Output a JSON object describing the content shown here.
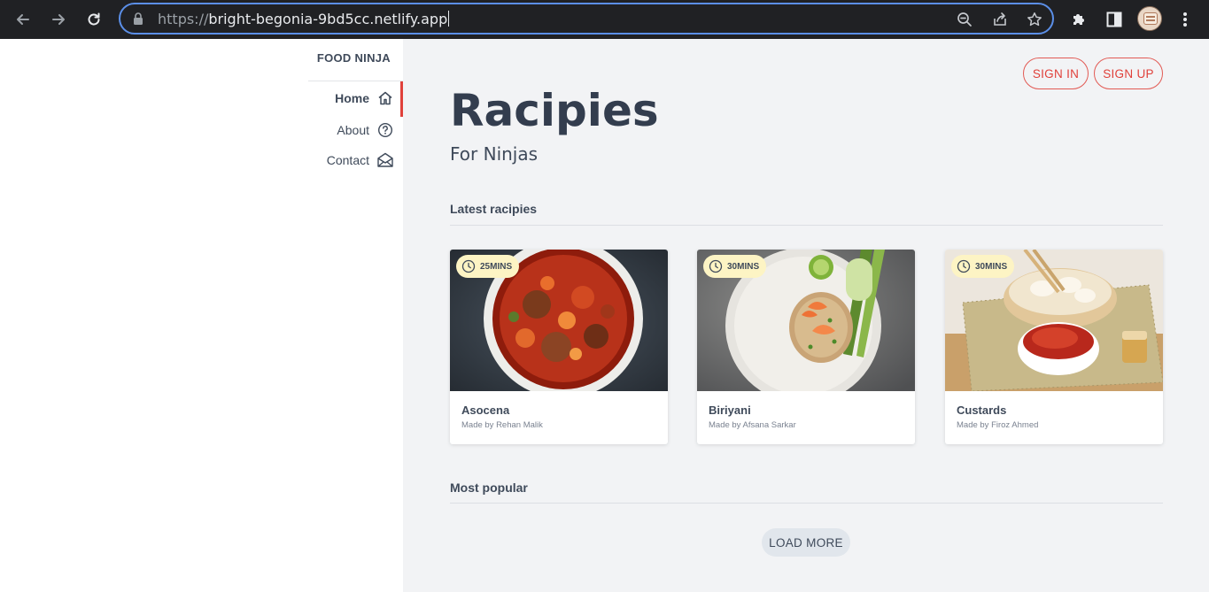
{
  "browser": {
    "url_scheme": "https://",
    "url_host": "bright-begonia-9bd5cc.netlify.app"
  },
  "sidebar": {
    "brand": "FOOD NINJA",
    "items": [
      {
        "label": "Home",
        "icon": "home-icon",
        "active": true
      },
      {
        "label": "About",
        "icon": "question-circle-icon",
        "active": false
      },
      {
        "label": "Contact",
        "icon": "envelope-open-icon",
        "active": false
      }
    ]
  },
  "header": {
    "sign_in": "SIGN IN",
    "sign_up": "SIGN UP",
    "title": "Racipies",
    "subtitle": "For Ninjas"
  },
  "sections": {
    "latest": "Latest racipies",
    "popular": "Most popular"
  },
  "cards": [
    {
      "time": "25MINS",
      "name": "Asocena",
      "author": "Made by Rehan Malik"
    },
    {
      "time": "30MINS",
      "name": "Biriyani",
      "author": "Made by Afsana Sarkar"
    },
    {
      "time": "30MINS",
      "name": "Custards",
      "author": "Made by Firoz Ahmed"
    }
  ],
  "load_more": "LOAD MORE",
  "colors": {
    "accent": "#e0403a",
    "browser_bar": "#202124",
    "main_bg": "#f2f3f5",
    "text": "#3f4a5a",
    "badge_bg": "#fdf4c4"
  }
}
